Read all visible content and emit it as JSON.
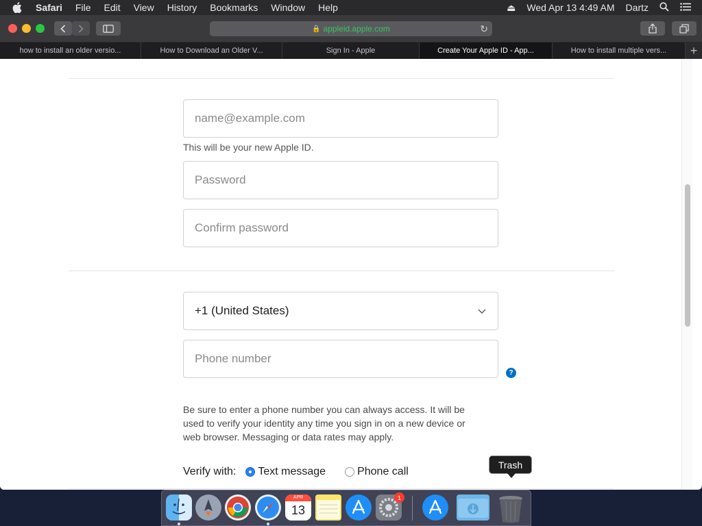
{
  "menubar": {
    "app_name": "Safari",
    "items": [
      "File",
      "Edit",
      "View",
      "History",
      "Bookmarks",
      "Window",
      "Help"
    ],
    "date_time": "Wed Apr 13  4:49 AM",
    "user": "Dartz"
  },
  "browser": {
    "url": "appleid.apple.com",
    "tabs": [
      {
        "label": "how to install an older versio..."
      },
      {
        "label": "How to Download an Older V..."
      },
      {
        "label": "Sign In - Apple"
      },
      {
        "label": "Create Your Apple ID - App...",
        "active": true
      },
      {
        "label": "How to install multiple vers..."
      }
    ],
    "new_tab_label": "+"
  },
  "form": {
    "email_placeholder": "name@example.com",
    "email_hint": "This will be your new Apple ID.",
    "password_placeholder": "Password",
    "confirm_password_placeholder": "Confirm password",
    "country_code_value": "+1 (United States)",
    "phone_placeholder": "Phone number",
    "help_label": "?",
    "phone_note": "Be sure to enter a phone number you can always access. It will be used to verify your identity any time you sign in on a new device or web browser. Messaging or data rates may apply.",
    "verify_label": "Verify with:",
    "verify_options": [
      {
        "label": "Text message",
        "selected": true
      },
      {
        "label": "Phone call",
        "selected": false
      }
    ]
  },
  "dock": {
    "apps": [
      "finder-icon",
      "launchpad-icon",
      "chrome-icon",
      "safari-icon",
      "calendar-icon",
      "notes-icon",
      "app-store-icon",
      "system-preferences-icon",
      "app-store-installer-icon",
      "downloads-folder-icon",
      "trash-icon"
    ],
    "calendar_month": "APR",
    "calendar_day": "13",
    "system_prefs_badge": "1",
    "tooltip": "Trash"
  },
  "colors": {
    "url_green": "#33c75a",
    "radio_accent": "#2f7ff0",
    "help_blue": "#0070c9"
  }
}
